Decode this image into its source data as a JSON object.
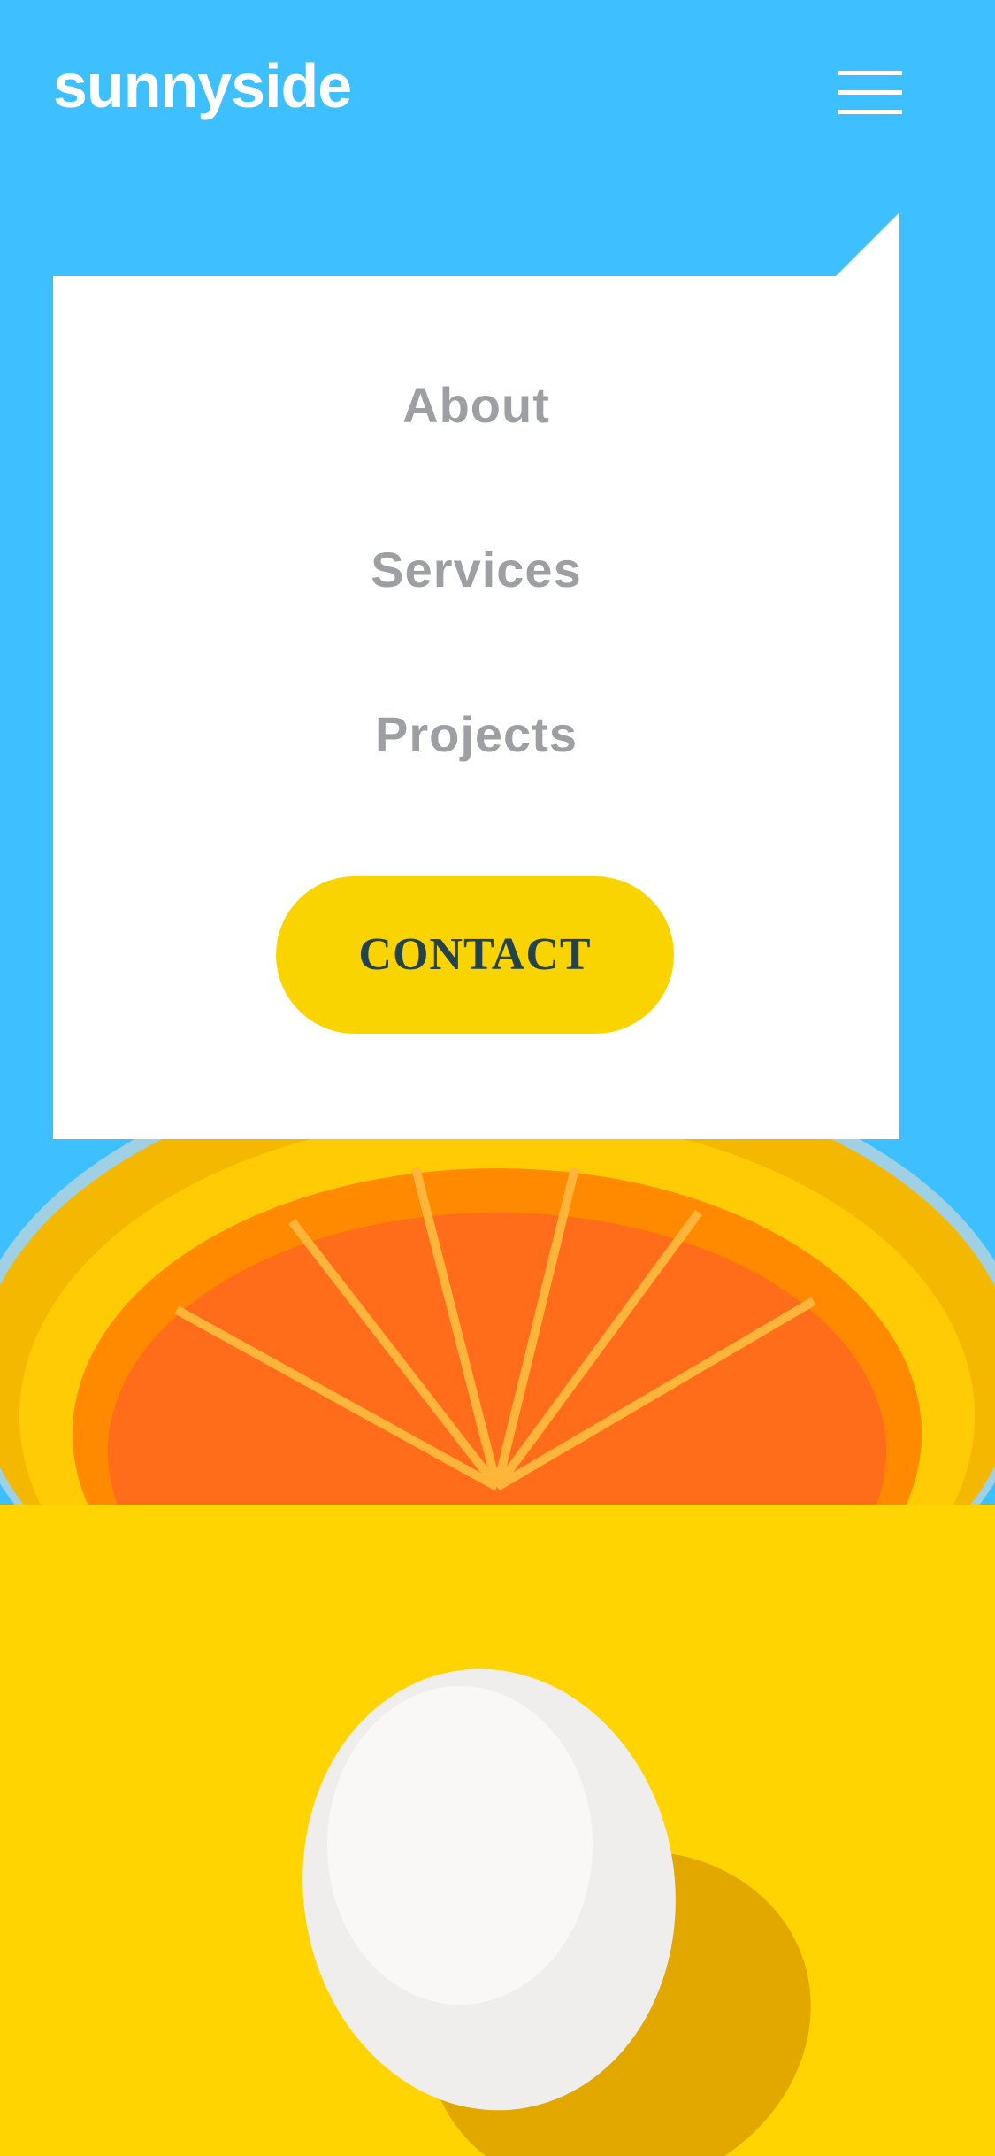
{
  "header": {
    "logo_text": "sunnyside",
    "menu_icon": "hamburger-menu-icon"
  },
  "nav_menu": {
    "items": [
      {
        "label": "About"
      },
      {
        "label": "Services"
      },
      {
        "label": "Projects"
      }
    ],
    "cta_label": "CONTACT"
  },
  "images": {
    "hero": "orange-half-image",
    "feature": "white-egg-image"
  },
  "colors": {
    "hero_background": "#3ebfff",
    "menu_background": "#ffffff",
    "menu_link": "#9e9fa3",
    "cta_background": "#fad400",
    "cta_text": "#23424a",
    "egg_background": "#ffd400"
  }
}
